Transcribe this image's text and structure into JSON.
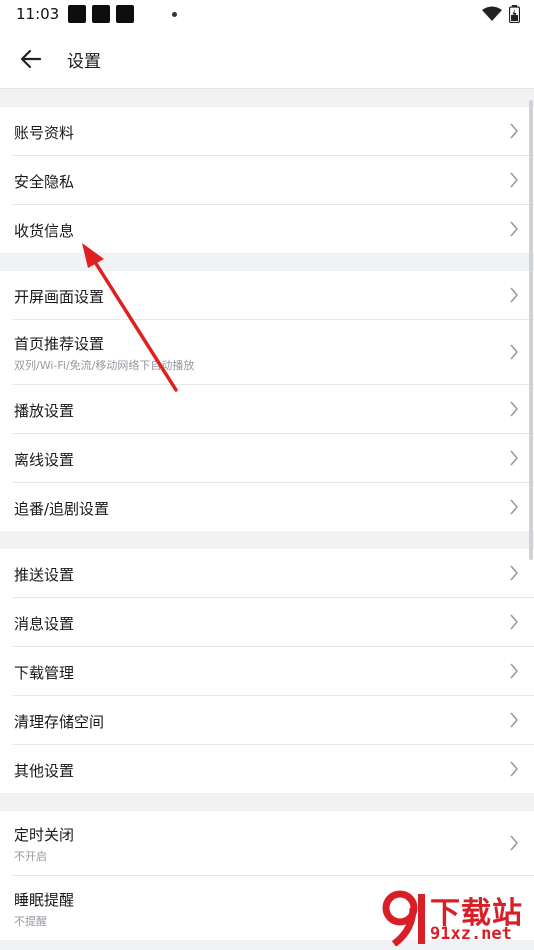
{
  "status_bar": {
    "time": "11:03"
  },
  "header": {
    "title": "设置"
  },
  "groups": [
    {
      "items": [
        {
          "label": "账号资料"
        },
        {
          "label": "安全隐私"
        },
        {
          "label": "收货信息"
        }
      ]
    },
    {
      "items": [
        {
          "label": "开屏画面设置"
        },
        {
          "label": "首页推荐设置",
          "sub": "双列/Wi-Fi/免流/移动网络下自动播放"
        },
        {
          "label": "播放设置"
        },
        {
          "label": "离线设置"
        },
        {
          "label": "追番/追剧设置"
        }
      ]
    },
    {
      "items": [
        {
          "label": "推送设置"
        },
        {
          "label": "消息设置"
        },
        {
          "label": "下载管理"
        },
        {
          "label": "清理存储空间"
        },
        {
          "label": "其他设置"
        }
      ]
    },
    {
      "items": [
        {
          "label": "定时关闭",
          "sub": "不开启"
        },
        {
          "label": "睡眠提醒",
          "sub": "不提醒"
        }
      ]
    }
  ],
  "watermark": {
    "title": "下载站",
    "url": "91xz.net"
  },
  "colors": {
    "annotation_arrow": "#e02020",
    "watermark": "#d81f26"
  }
}
